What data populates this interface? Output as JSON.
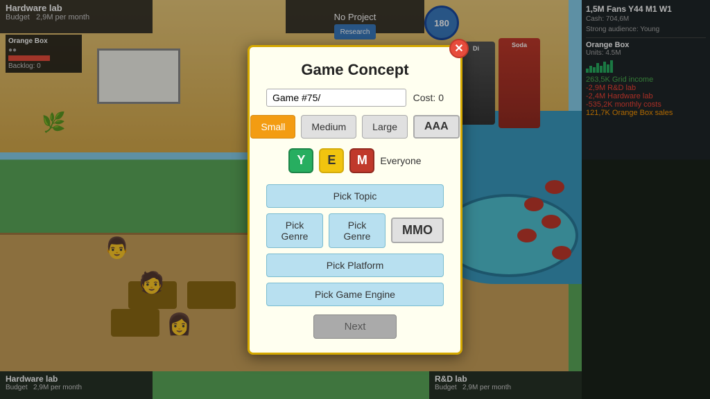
{
  "game": {
    "title": "Hardware lab",
    "budget_label": "Budget",
    "budget_value": "2,9M per month",
    "no_project": "No Project",
    "research_label": "Research",
    "fans_count": "180"
  },
  "stats": {
    "fans": "1,5M Fans Y44 M1 W1",
    "cash": "Cash: 704,6M",
    "audience": "Strong audience: Young",
    "product": "Orange Box",
    "units": "Units: 4.5M",
    "grid_income": "263,5K  Grid income",
    "rd_lab": "-2,9M  R&D lab",
    "hardware_lab": "-2,4M  Hardware lab",
    "monthly_costs": "-535,2K monthly costs",
    "orange_box_sales": "121,7K  Orange Box sales"
  },
  "orange_box_widget": {
    "title": "Orange Box",
    "backlog": "Backlog: 0"
  },
  "bottom_left": {
    "title": "Hardware lab",
    "budget_label": "Budget",
    "budget_value": "2,9M per month"
  },
  "bottom_right": {
    "title": "R&D lab",
    "budget_label": "Budget",
    "budget_value": "2,9M per month"
  },
  "dialog": {
    "title": "Game Concept",
    "name_value": "Game #75/",
    "cost_label": "Cost: 0",
    "close_label": "✕",
    "sizes": [
      {
        "label": "Small",
        "active": true
      },
      {
        "label": "Medium",
        "active": false
      },
      {
        "label": "Large",
        "active": false
      }
    ],
    "aaa_label": "AAA",
    "ratings": [
      {
        "label": "Y",
        "class": "rating-y"
      },
      {
        "label": "E",
        "class": "rating-e"
      },
      {
        "label": "M",
        "class": "rating-m"
      }
    ],
    "audience_label": "Everyone",
    "pick_topic": "Pick Topic",
    "pick_genre_1": "Pick Genre",
    "pick_genre_2": "Pick Genre",
    "mmo_label": "MMO",
    "pick_platform": "Pick Platform",
    "pick_engine": "Pick Game Engine",
    "next_label": "Next"
  }
}
